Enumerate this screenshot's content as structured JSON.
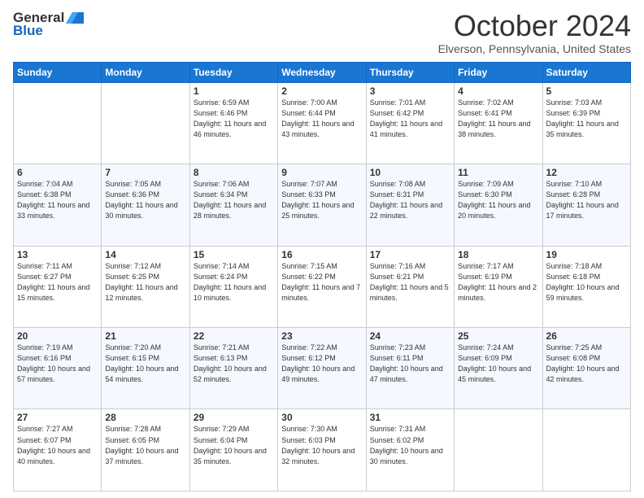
{
  "header": {
    "logo_general": "General",
    "logo_blue": "Blue",
    "month_title": "October 2024",
    "location": "Elverson, Pennsylvania, United States"
  },
  "days_of_week": [
    "Sunday",
    "Monday",
    "Tuesday",
    "Wednesday",
    "Thursday",
    "Friday",
    "Saturday"
  ],
  "weeks": [
    [
      {
        "day": "",
        "info": ""
      },
      {
        "day": "",
        "info": ""
      },
      {
        "day": "1",
        "info": "Sunrise: 6:59 AM\nSunset: 6:46 PM\nDaylight: 11 hours and 46 minutes."
      },
      {
        "day": "2",
        "info": "Sunrise: 7:00 AM\nSunset: 6:44 PM\nDaylight: 11 hours and 43 minutes."
      },
      {
        "day": "3",
        "info": "Sunrise: 7:01 AM\nSunset: 6:42 PM\nDaylight: 11 hours and 41 minutes."
      },
      {
        "day": "4",
        "info": "Sunrise: 7:02 AM\nSunset: 6:41 PM\nDaylight: 11 hours and 38 minutes."
      },
      {
        "day": "5",
        "info": "Sunrise: 7:03 AM\nSunset: 6:39 PM\nDaylight: 11 hours and 35 minutes."
      }
    ],
    [
      {
        "day": "6",
        "info": "Sunrise: 7:04 AM\nSunset: 6:38 PM\nDaylight: 11 hours and 33 minutes."
      },
      {
        "day": "7",
        "info": "Sunrise: 7:05 AM\nSunset: 6:36 PM\nDaylight: 11 hours and 30 minutes."
      },
      {
        "day": "8",
        "info": "Sunrise: 7:06 AM\nSunset: 6:34 PM\nDaylight: 11 hours and 28 minutes."
      },
      {
        "day": "9",
        "info": "Sunrise: 7:07 AM\nSunset: 6:33 PM\nDaylight: 11 hours and 25 minutes."
      },
      {
        "day": "10",
        "info": "Sunrise: 7:08 AM\nSunset: 6:31 PM\nDaylight: 11 hours and 22 minutes."
      },
      {
        "day": "11",
        "info": "Sunrise: 7:09 AM\nSunset: 6:30 PM\nDaylight: 11 hours and 20 minutes."
      },
      {
        "day": "12",
        "info": "Sunrise: 7:10 AM\nSunset: 6:28 PM\nDaylight: 11 hours and 17 minutes."
      }
    ],
    [
      {
        "day": "13",
        "info": "Sunrise: 7:11 AM\nSunset: 6:27 PM\nDaylight: 11 hours and 15 minutes."
      },
      {
        "day": "14",
        "info": "Sunrise: 7:12 AM\nSunset: 6:25 PM\nDaylight: 11 hours and 12 minutes."
      },
      {
        "day": "15",
        "info": "Sunrise: 7:14 AM\nSunset: 6:24 PM\nDaylight: 11 hours and 10 minutes."
      },
      {
        "day": "16",
        "info": "Sunrise: 7:15 AM\nSunset: 6:22 PM\nDaylight: 11 hours and 7 minutes."
      },
      {
        "day": "17",
        "info": "Sunrise: 7:16 AM\nSunset: 6:21 PM\nDaylight: 11 hours and 5 minutes."
      },
      {
        "day": "18",
        "info": "Sunrise: 7:17 AM\nSunset: 6:19 PM\nDaylight: 11 hours and 2 minutes."
      },
      {
        "day": "19",
        "info": "Sunrise: 7:18 AM\nSunset: 6:18 PM\nDaylight: 10 hours and 59 minutes."
      }
    ],
    [
      {
        "day": "20",
        "info": "Sunrise: 7:19 AM\nSunset: 6:16 PM\nDaylight: 10 hours and 57 minutes."
      },
      {
        "day": "21",
        "info": "Sunrise: 7:20 AM\nSunset: 6:15 PM\nDaylight: 10 hours and 54 minutes."
      },
      {
        "day": "22",
        "info": "Sunrise: 7:21 AM\nSunset: 6:13 PM\nDaylight: 10 hours and 52 minutes."
      },
      {
        "day": "23",
        "info": "Sunrise: 7:22 AM\nSunset: 6:12 PM\nDaylight: 10 hours and 49 minutes."
      },
      {
        "day": "24",
        "info": "Sunrise: 7:23 AM\nSunset: 6:11 PM\nDaylight: 10 hours and 47 minutes."
      },
      {
        "day": "25",
        "info": "Sunrise: 7:24 AM\nSunset: 6:09 PM\nDaylight: 10 hours and 45 minutes."
      },
      {
        "day": "26",
        "info": "Sunrise: 7:25 AM\nSunset: 6:08 PM\nDaylight: 10 hours and 42 minutes."
      }
    ],
    [
      {
        "day": "27",
        "info": "Sunrise: 7:27 AM\nSunset: 6:07 PM\nDaylight: 10 hours and 40 minutes."
      },
      {
        "day": "28",
        "info": "Sunrise: 7:28 AM\nSunset: 6:05 PM\nDaylight: 10 hours and 37 minutes."
      },
      {
        "day": "29",
        "info": "Sunrise: 7:29 AM\nSunset: 6:04 PM\nDaylight: 10 hours and 35 minutes."
      },
      {
        "day": "30",
        "info": "Sunrise: 7:30 AM\nSunset: 6:03 PM\nDaylight: 10 hours and 32 minutes."
      },
      {
        "day": "31",
        "info": "Sunrise: 7:31 AM\nSunset: 6:02 PM\nDaylight: 10 hours and 30 minutes."
      },
      {
        "day": "",
        "info": ""
      },
      {
        "day": "",
        "info": ""
      }
    ]
  ]
}
